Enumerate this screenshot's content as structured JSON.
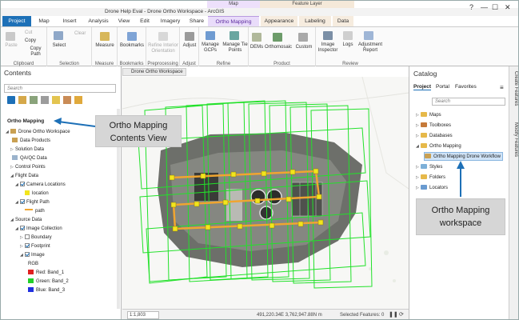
{
  "window": {
    "title": "Drone Help Eval - Drone Ortho Workspace - ArcGIS Pro",
    "context_map": "Map",
    "context_feature": "Feature Layer",
    "help": "?",
    "minimize": "—",
    "maximize": "☐",
    "close": "✕"
  },
  "tabs": [
    "Project",
    "Map",
    "Insert",
    "Analysis",
    "View",
    "Edit",
    "Imagery",
    "Share",
    "Ortho Mapping",
    "Appearance",
    "Labeling",
    "Data"
  ],
  "ribbon": {
    "clipboard": {
      "label": "Clipboard",
      "paste": "Paste",
      "cut": "Cut",
      "copy": "Copy",
      "copy_path": "Copy Path"
    },
    "selection": {
      "label": "Selection",
      "select": "Select",
      "clear": "Clear"
    },
    "measure": {
      "label": "Measure",
      "measure": "Measure"
    },
    "bookmarks": {
      "label": "Bookmarks",
      "bookmarks": "Bookmarks"
    },
    "preprocessing": {
      "label": "Preprocessing",
      "refine": "Refine Interior",
      "orientation": "Orientation"
    },
    "adjust": {
      "label": "Adjust",
      "adjust": "Adjust"
    },
    "refine": {
      "label": "Refine",
      "gcps": "Manage GCPs",
      "tiepoints": "Manage Tie Points"
    },
    "product": {
      "label": "Product",
      "dems": "DEMs",
      "ortho": "Orthomosaic",
      "custom": "Custom"
    },
    "review": {
      "label": "Review",
      "inspector": "Image Inspector",
      "logs": "Logs",
      "report": "Adjustment Report"
    }
  },
  "contents": {
    "title": "Contents",
    "search_placeholder": "Search",
    "tree": [
      {
        "label": "Ortho Mapping",
        "bold": true
      },
      {
        "label": "Drone Ortho Workspace"
      },
      {
        "label": "Data Products"
      },
      {
        "label": "Solution Data"
      },
      {
        "label": "QA/QC Data"
      },
      {
        "label": "Control Points"
      },
      {
        "label": "Flight Data"
      },
      {
        "label": "Camera Locations"
      },
      {
        "label": "location"
      },
      {
        "label": "Flight Path"
      },
      {
        "label": "path"
      },
      {
        "label": "Source Data"
      },
      {
        "label": "Image Collection"
      },
      {
        "label": "Boundary"
      },
      {
        "label": "Footprint"
      },
      {
        "label": "Image"
      },
      {
        "label": "RGB"
      },
      {
        "label": "Red: Band_1"
      },
      {
        "label": "Green: Band_2"
      },
      {
        "label": "Blue: Band_3"
      }
    ]
  },
  "map": {
    "tab": "Drone Ortho Workspace",
    "scale": "1:1,803",
    "coords": "491,220.34E 3,762,947.88N m",
    "selected": "Selected Features: 0"
  },
  "catalog": {
    "title": "Catalog",
    "tabs": [
      "Project",
      "Portal",
      "Favorites"
    ],
    "search_placeholder": "Search",
    "items": [
      "Maps",
      "Toolboxes",
      "Databases",
      "Ortho Mapping",
      "Ortho Mapping Drone Workflow",
      "Styles",
      "Folders",
      "Locators"
    ]
  },
  "side_panels": [
    "Create Features",
    "Modify Features"
  ],
  "callouts": {
    "contents_line1": "Ortho Mapping",
    "contents_line2": "Contents View",
    "workspace_line1": "Ortho Mapping",
    "workspace_line2": "workspace"
  },
  "colors": {
    "accent": "#1d70b7",
    "footprint": "#22e12a",
    "flightpath": "#f0a530",
    "point": "#f2e51c"
  }
}
